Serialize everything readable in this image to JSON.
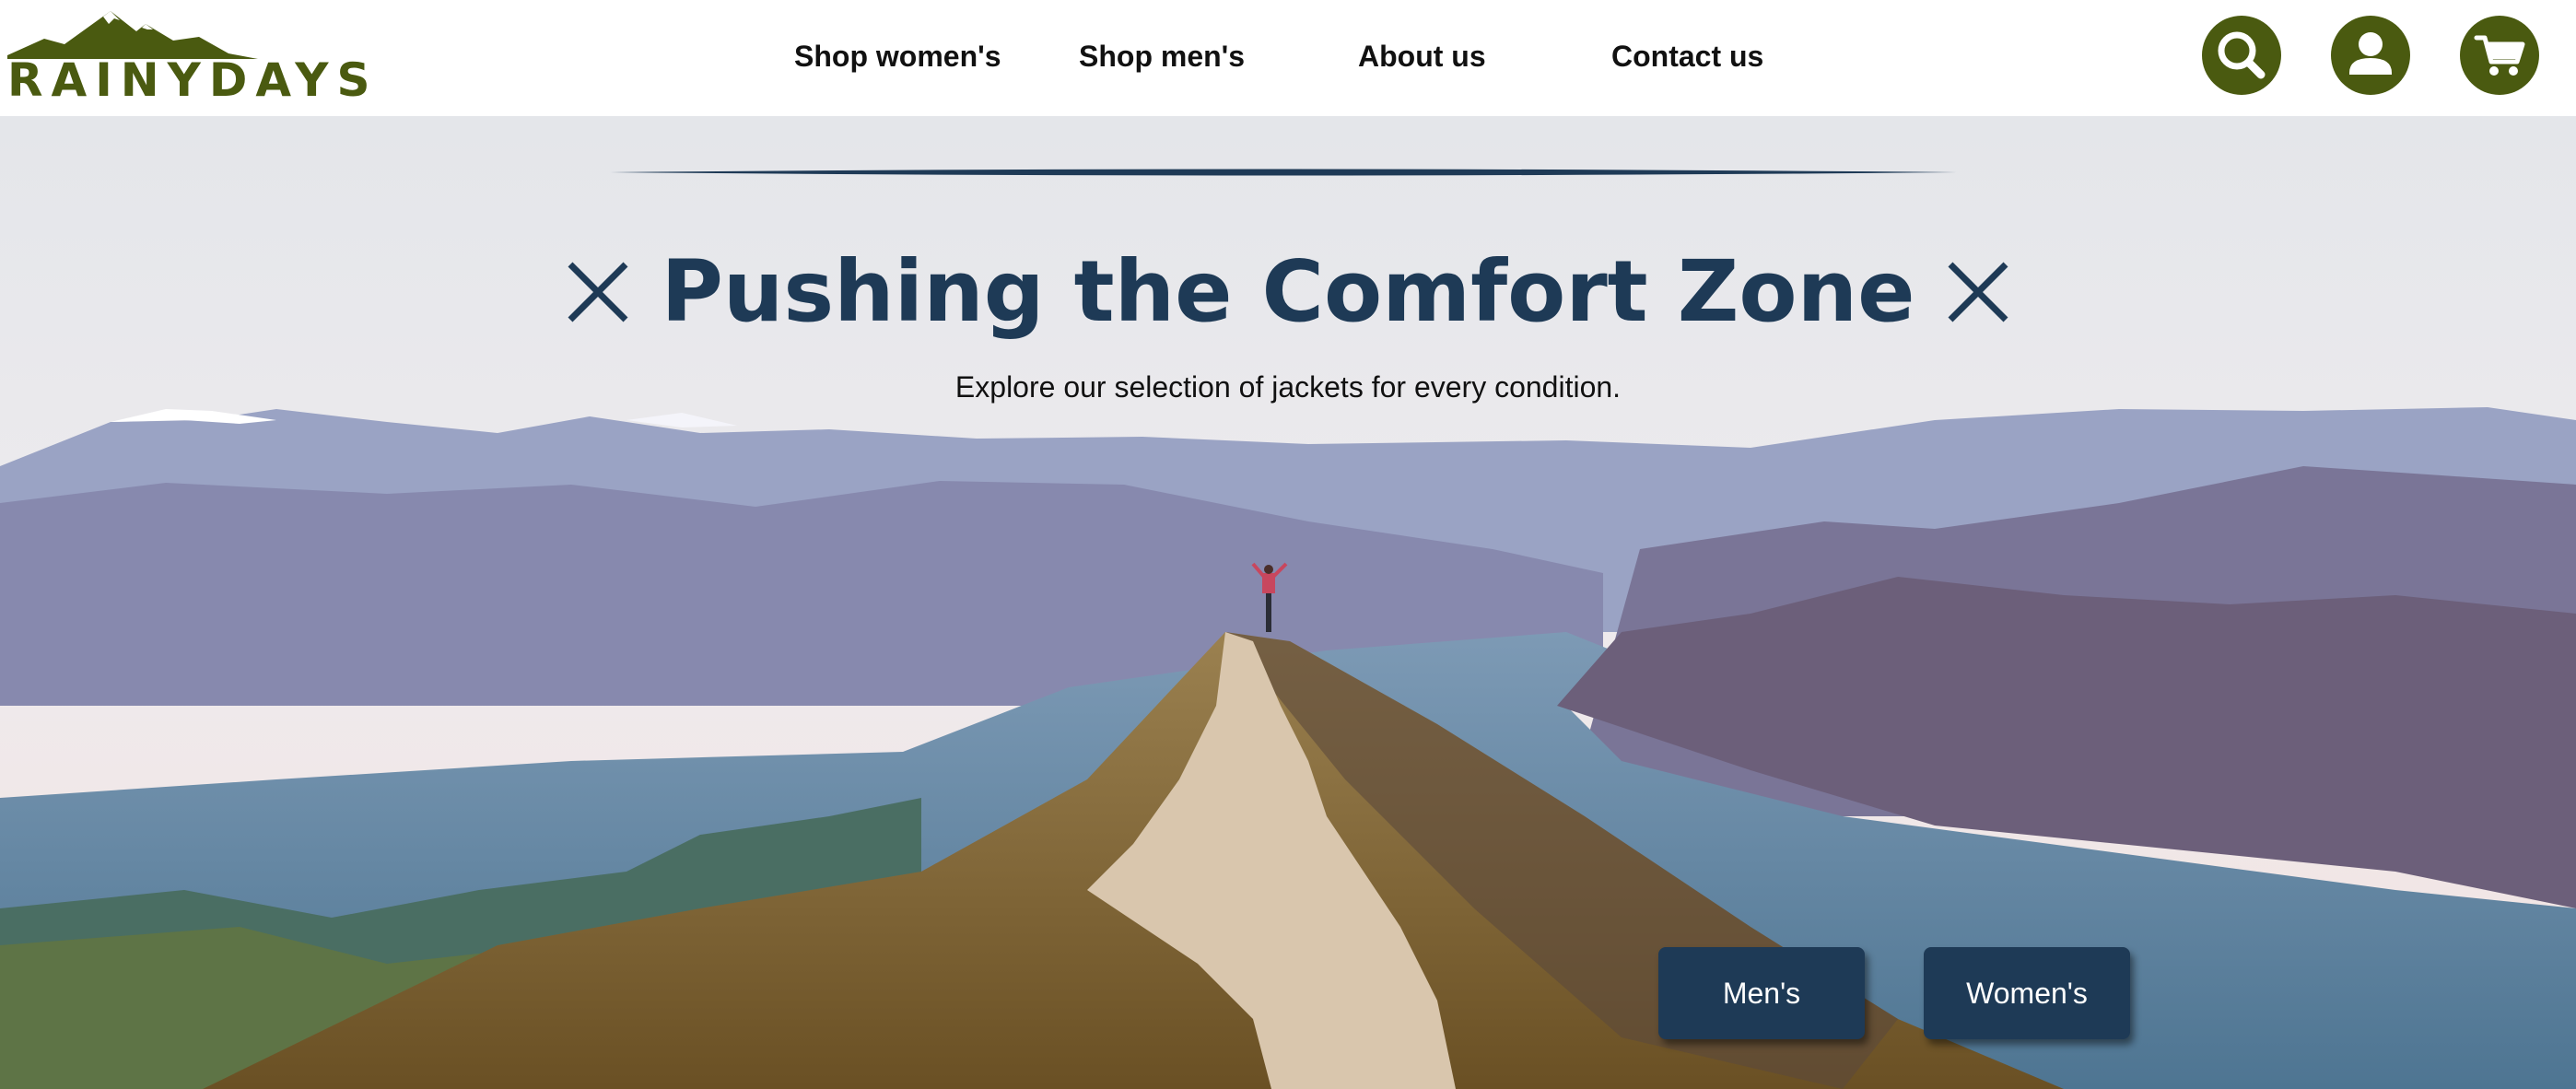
{
  "brand": {
    "name": "RAINYDAYS",
    "logo_color": "#4a5a10"
  },
  "nav": {
    "items": [
      {
        "label": "Shop women's"
      },
      {
        "label": "Shop men's"
      },
      {
        "label": "About us"
      },
      {
        "label": "Contact us"
      }
    ]
  },
  "header_icons": [
    {
      "name": "search-icon"
    },
    {
      "name": "account-icon"
    },
    {
      "name": "cart-icon"
    }
  ],
  "hero": {
    "title": "Pushing the Comfort Zone",
    "subtitle": "Explore our selection of jackets for every condition.",
    "accent_color": "#1e3a56",
    "buttons": {
      "men_label": "Men's",
      "women_label": "Women's"
    }
  }
}
